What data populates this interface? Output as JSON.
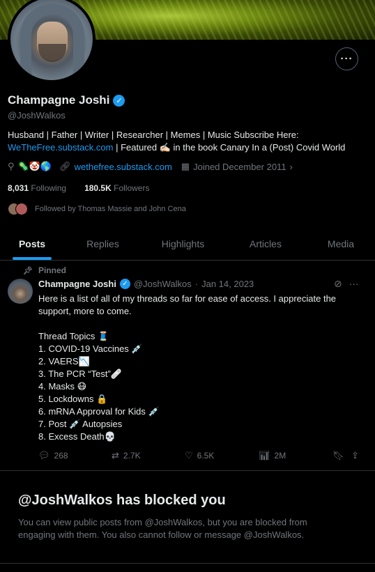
{
  "profile": {
    "name": "Champagne Joshi",
    "handle": "@JoshWalkos",
    "bio_line1": "Husband | Father | Writer | Researcher | Memes | Music Subscribe Here:",
    "bio_link": "WeTheFree.substack.com",
    "bio_line2_rest": " | Featured ✍🏻 in the book Canary In a (Post) Covid World",
    "location_emojis": "🦠🤡🌎",
    "website": "wethefree.substack.com",
    "joined": "Joined December 2011",
    "following_count": "8,031",
    "following_label": "Following",
    "followers_count": "180.5K",
    "followers_label": "Followers",
    "followed_by": "Followed by Thomas Massie and John Cena"
  },
  "tabs": [
    {
      "label": "Posts",
      "active": true
    },
    {
      "label": "Replies",
      "active": false
    },
    {
      "label": "Highlights",
      "active": false
    },
    {
      "label": "Articles",
      "active": false
    },
    {
      "label": "Media",
      "active": false
    }
  ],
  "post": {
    "pinned_label": "Pinned",
    "author_name": "Champagne Joshi",
    "author_handle": "@JoshWalkos",
    "separator": "·",
    "date": "Jan 14, 2023",
    "text_line1": "Here is a list of all of my threads so far for ease of access. I appreciate the",
    "text_line2": "support, more to come.",
    "topics_header": "Thread Topics 🧵",
    "topics": [
      "1. COVID-19 Vaccines 💉",
      "2. VAERS📉",
      "3. The PCR “Test”🩹",
      "4. Masks 😷",
      "5. Lockdowns 🔒",
      "6. mRNA Approval for Kids 💉",
      "7. Post 💉 Autopsies",
      "8. Excess Death💀"
    ],
    "replies": "268",
    "reposts": "2.7K",
    "likes": "6.5K",
    "views": "2M"
  },
  "blocked": {
    "title": "@JoshWalkos has blocked you",
    "message": "You can view public posts from @JoshWalkos, but you are blocked from engaging with them. You also cannot follow or message @JoshWalkos."
  },
  "colors": {
    "accent": "#1d9bf0",
    "muted": "#71767b",
    "border": "#2f3336",
    "text": "#e7e9ea"
  }
}
